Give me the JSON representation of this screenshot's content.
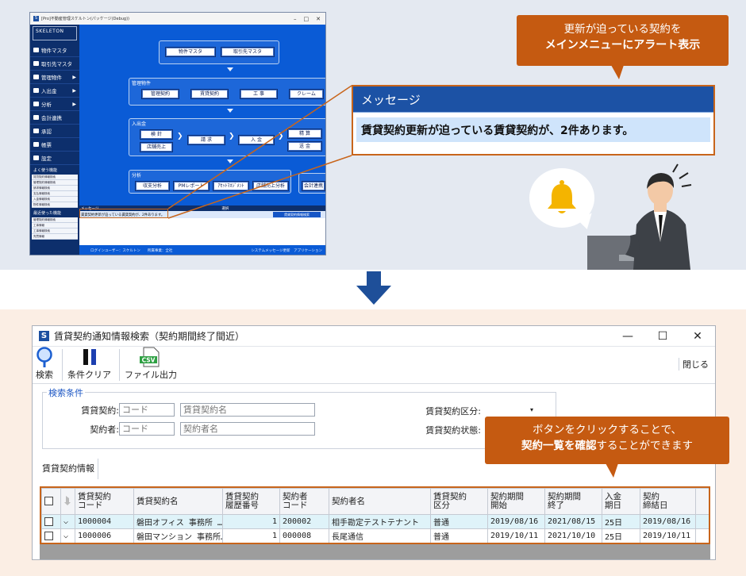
{
  "top": {
    "app": {
      "title": "[Pro]不動産管理スケルトン(パッケージ(Debug))",
      "logo": "SKELETON",
      "sidebar": [
        {
          "label": "物件マスタ",
          "icon": "home-icon",
          "arrow": ""
        },
        {
          "label": "取引先マスタ",
          "icon": "people-icon",
          "arrow": ""
        },
        {
          "label": "管理物件",
          "icon": "building-icon",
          "arrow": "▶"
        },
        {
          "label": "入出金",
          "icon": "transfer-icon",
          "arrow": "▶"
        },
        {
          "label": "分析",
          "icon": "chart-icon",
          "arrow": "▶"
        },
        {
          "label": "会計連携",
          "icon": "yen-icon",
          "arrow": ""
        },
        {
          "label": "承認",
          "icon": "check-icon",
          "arrow": ""
        },
        {
          "label": "帳票",
          "icon": "document-icon",
          "arrow": ""
        },
        {
          "label": "設定",
          "icon": "gear-icon",
          "arrow": ""
        }
      ],
      "frequent_head": "よく使う機能",
      "frequent": [
        "賃貸契約情報検索",
        "管理契約情報検索",
        "請求情報検索",
        "支払情報検索",
        "入金情報検索",
        "物件情報検索"
      ],
      "recent_head": "最近使った機能",
      "recent": [
        "管理契約情報検索",
        "工事情報",
        "工事情報検索",
        "売買情報"
      ],
      "flow": {
        "masters": [
          "物件マスタ",
          "取引先マスタ"
        ],
        "managed_label": "管理物件",
        "managed": [
          "管理契約",
          "賃貸契約",
          "工 事",
          "クレーム"
        ],
        "cash_label": "入出金",
        "cash_left": [
          "検 針",
          "店舗売上"
        ],
        "cash_mid": [
          "請 求",
          "入 金"
        ],
        "cash_right": [
          "精 算",
          "送 金"
        ],
        "analysis_label": "分析",
        "analysis": [
          "収支分析",
          "PMレポート",
          "ｱｾｯﾄﾏﾈｼﾞﾒﾝﾄ",
          "店舗売上分析"
        ],
        "accounting": "会計連携"
      },
      "message": {
        "head": "メッセージ",
        "select_head": "選択",
        "row": "賃貸契約更新が迫っている賃貸契約が、2件あります。",
        "button": "賃貸契約情報検索"
      },
      "status_left": "ログインユーザー：スケルトン　　所属事業：全社",
      "status_right": "システムメッセージ更新　アプリケーション"
    },
    "zoom": {
      "head": "メッセージ",
      "row": "賃貸契約更新が迫っている賃貸契約が、2件あります。"
    },
    "callout": {
      "line1": "更新が迫っている契約を",
      "line2": "メインメニューにアラート表示"
    }
  },
  "window": {
    "title": "賃貸契約通知情報検索（契約期間終了間近）",
    "logo": "S",
    "controls": [
      "—",
      "☐",
      "✕"
    ],
    "toolbar": {
      "search": "検索",
      "clear": "条件クリア",
      "csv_badge": "CSV",
      "export": "ファイル出力",
      "close": "閉じる"
    },
    "criteria": {
      "title": "検索条件",
      "contract_label": "賃貸契約:",
      "contract_code_ph": "コード",
      "contract_name_ph": "賃貸契約名",
      "contractor_label": "契約者:",
      "contractor_code_ph": "コード",
      "contractor_name_ph": "契約者名",
      "category_label": "賃貸契約区分:",
      "category_value": "▾",
      "status_label": "賃貸契約状態:"
    },
    "tab": "賃貸契約情報",
    "grid": {
      "headers": [
        "賃貸契約\nコード",
        "賃貸契約名",
        "賃貸契約\n履歴番号",
        "契約者\nコード",
        "契約者名",
        "賃貸契約\n区分",
        "契約期間\n開始",
        "契約期間\n終了",
        "入金\n期日",
        "契約\n締結日"
      ],
      "rows": [
        [
          "1000004",
          "磐田オフィス 事務所 …",
          "1",
          "200002",
          "相手勘定テストテナント",
          "普通",
          "2019/08/16",
          "2021/08/15",
          "25日",
          "2019/08/16"
        ],
        [
          "1000006",
          "磐田マンション 事務所…",
          "1",
          "000008",
          "長尾通信",
          "普通",
          "2019/10/11",
          "2021/10/10",
          "25日",
          "2019/10/11"
        ]
      ]
    }
  },
  "callout_bottom": {
    "line1": "ボタンをクリックすることで、",
    "line2_strong": "契約一覧を確認",
    "line2_rest": "することができます"
  },
  "colors": {
    "accent": "#c55a11",
    "app_blue": "#0a5bd6",
    "navy": "#0d2f6c"
  }
}
